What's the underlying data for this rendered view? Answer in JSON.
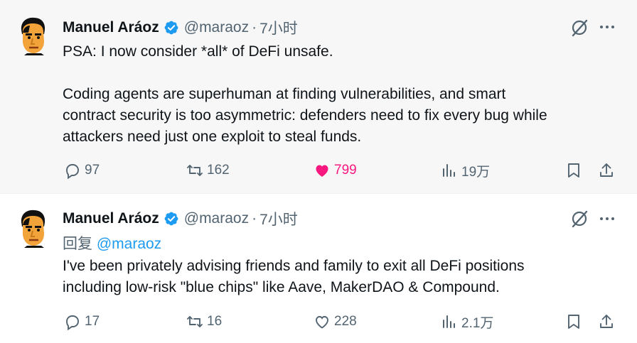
{
  "tweets": [
    {
      "author_name": "Manuel Aráoz",
      "handle": "@maraoz",
      "separator": "·",
      "time": "7小时",
      "text_lines": [
        "PSA: I now consider *all* of DeFi unsafe.",
        "",
        "Coding agents are superhuman at finding vulnerabilities, and smart",
        "contract security is too asymmetric: defenders need to fix every bug while",
        "attackers need just one exploit to steal funds."
      ],
      "replies": "97",
      "reposts": "162",
      "likes": "799",
      "liked": true,
      "views": "19万"
    },
    {
      "author_name": "Manuel Aráoz",
      "handle": "@maraoz",
      "separator": "·",
      "time": "7小时",
      "reply_prefix": "回复",
      "reply_to": "@maraoz",
      "text_lines": [
        "I've been privately advising friends and family to exit all DeFi positions",
        "including low-risk \"blue chips\" like Aave, MakerDAO & Compound."
      ],
      "replies": "17",
      "reposts": "16",
      "likes": "228",
      "liked": false,
      "views": "2.1万"
    }
  ],
  "colors": {
    "verified": "#1d9bf0",
    "like_active": "#f91880",
    "secondary": "#536471",
    "link": "#1d9bf0"
  },
  "icons": [
    "verified-badge-icon",
    "grok-icon",
    "more-icon",
    "reply-icon",
    "repost-icon",
    "like-icon",
    "views-icon",
    "bookmark-icon",
    "share-icon"
  ]
}
